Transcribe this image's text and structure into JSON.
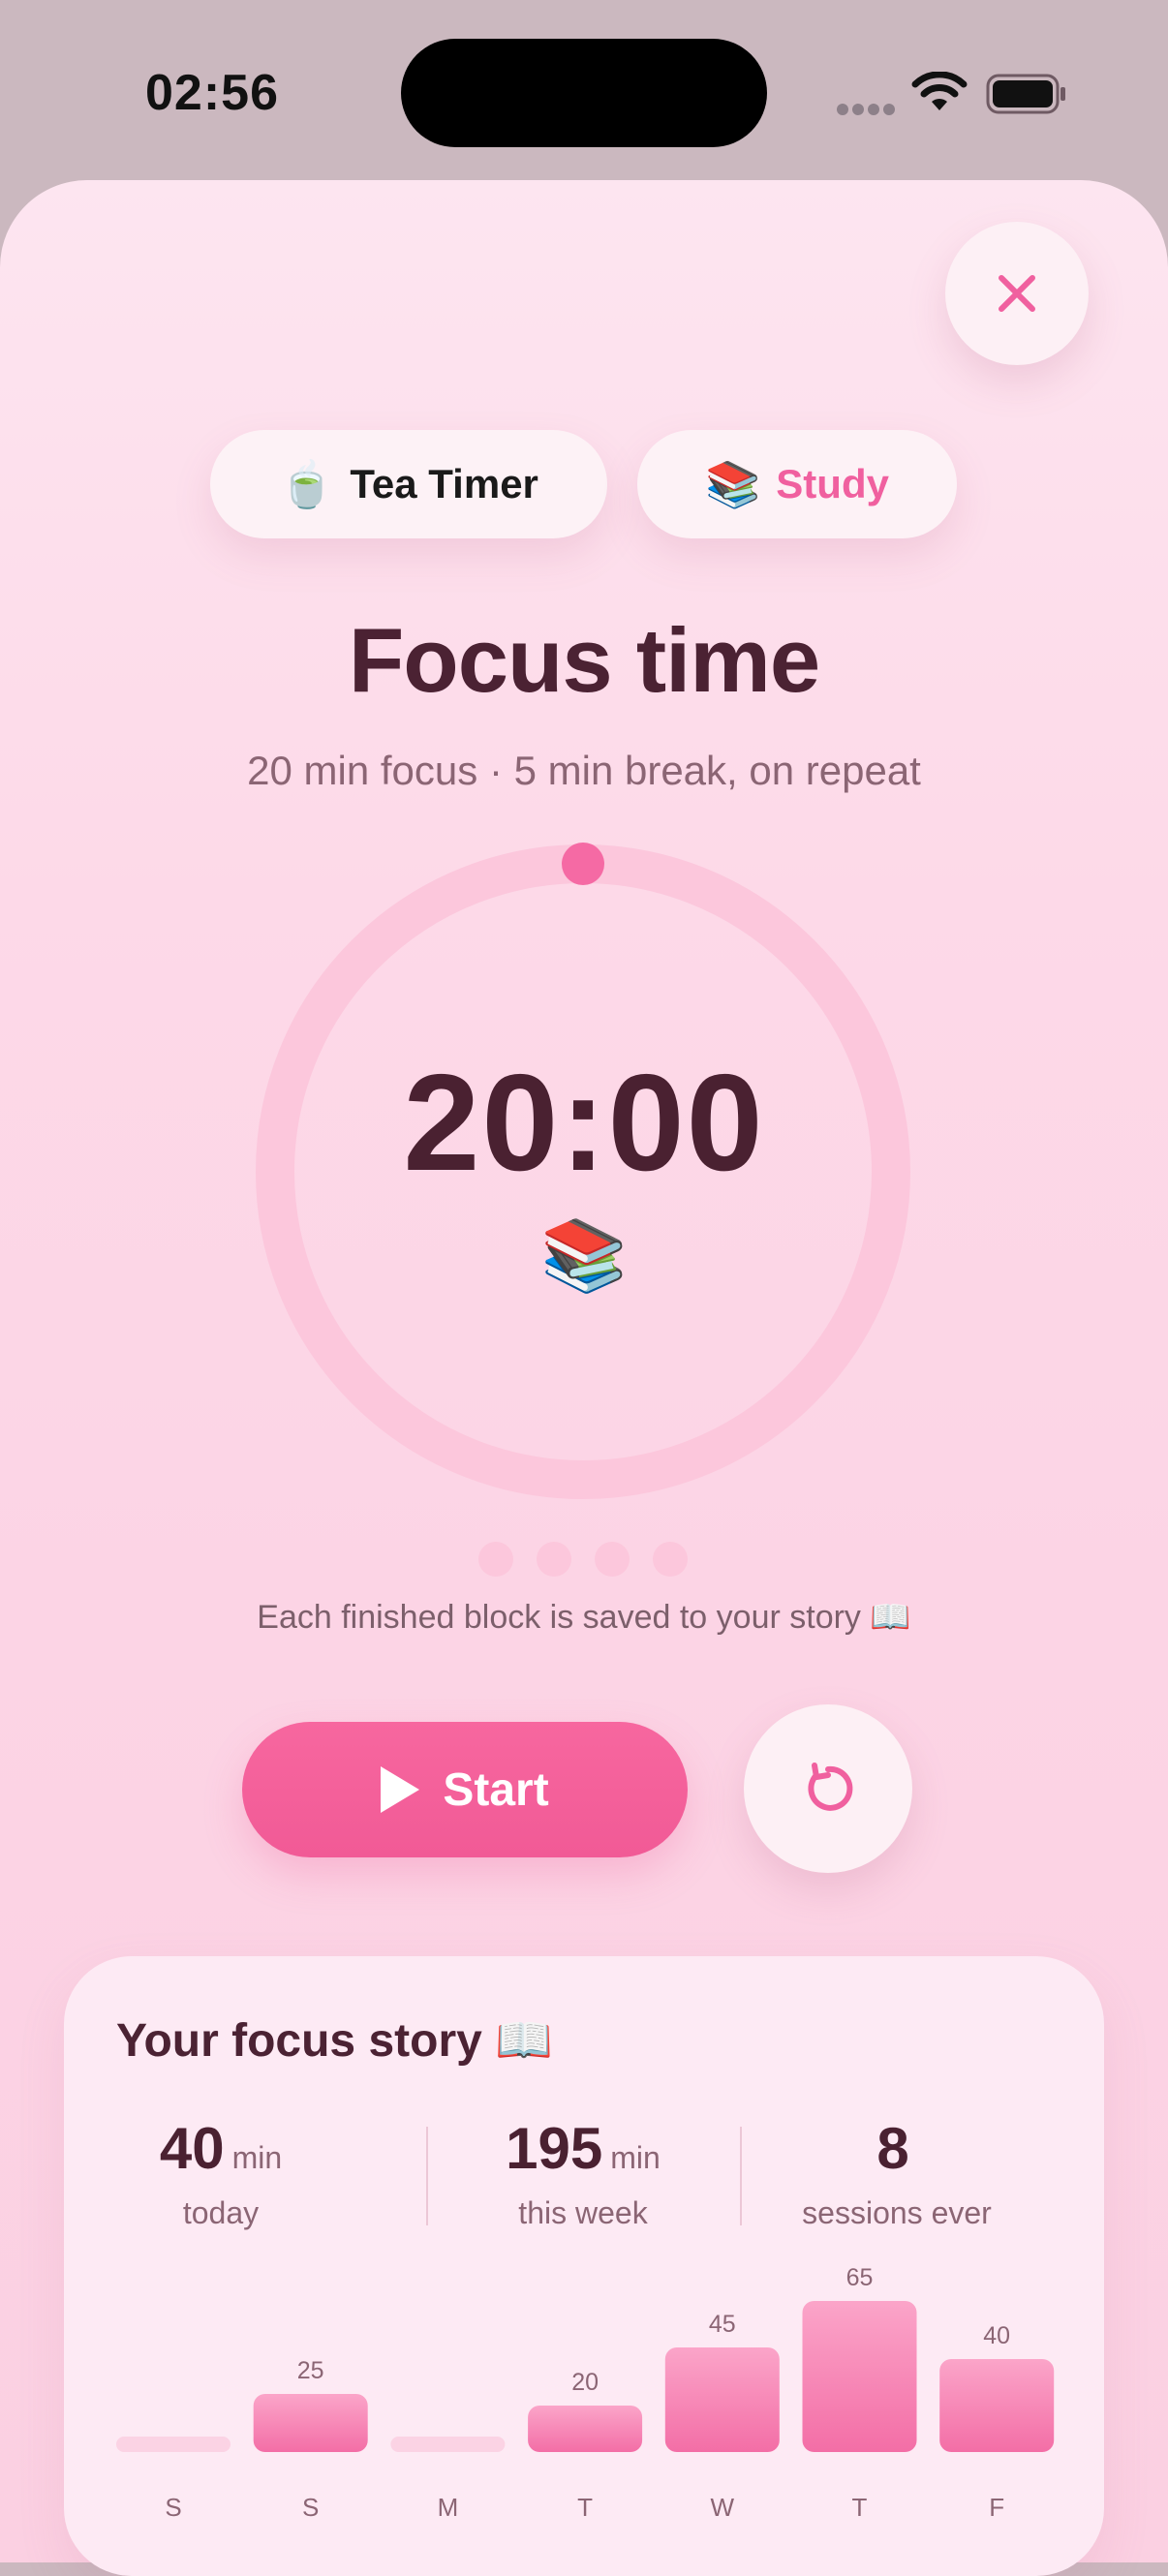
{
  "status_bar": {
    "time": "02:56"
  },
  "close_label": "×",
  "modes": [
    {
      "emoji": "🍵",
      "label": "Tea Timer"
    },
    {
      "emoji": "📚",
      "label": "Study"
    }
  ],
  "title": "Focus time",
  "subtitle": "20 min focus · 5 min break, on repeat",
  "timer": {
    "display": "20:00",
    "emoji": "📚",
    "progress": 0
  },
  "blocks": {
    "total": 4,
    "completed": 0
  },
  "caption": "Each finished block is saved to your story 📖",
  "start_label": "Start",
  "story": {
    "title": "Your focus story 📖",
    "stats": [
      {
        "value": "40",
        "unit": "min",
        "label": "today"
      },
      {
        "value": "195",
        "unit": "min",
        "label": "this week"
      },
      {
        "value": "8",
        "unit": "",
        "label": "sessions ever"
      }
    ]
  },
  "colors": {
    "accent": "#f0609f",
    "text": "#4b2233",
    "muted": "#8b6574",
    "ring": "#fcc7dc"
  },
  "chart_data": {
    "type": "bar",
    "categories": [
      "S",
      "S",
      "M",
      "T",
      "W",
      "T",
      "F"
    ],
    "values": [
      0,
      25,
      0,
      20,
      45,
      65,
      40
    ],
    "ylim": [
      0,
      65
    ]
  }
}
